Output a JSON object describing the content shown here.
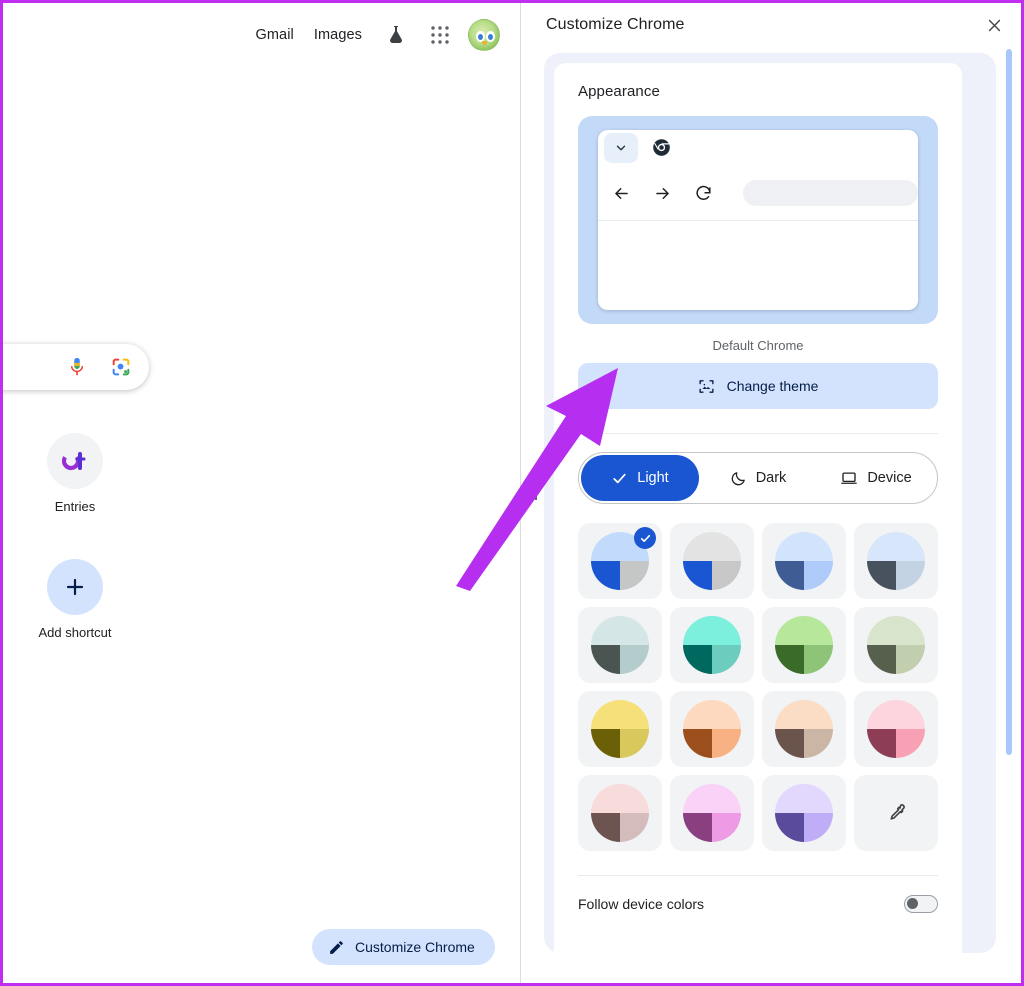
{
  "ntp": {
    "header": {
      "links": [
        {
          "label": "Gmail",
          "name": "gmail-link"
        },
        {
          "label": "Images",
          "name": "images-link"
        }
      ],
      "labs_icon": "flask-icon",
      "apps_icon": "apps-grid-icon",
      "avatar": "account-avatar"
    },
    "search": {
      "voice_icon": "microphone-icon",
      "lens_icon": "google-lens-icon"
    },
    "shortcuts": [
      {
        "label": "Entries",
        "tile": "ot-favicon",
        "style": "grey"
      },
      {
        "label": "Add shortcut",
        "tile": "plus-icon",
        "style": "blue"
      }
    ],
    "customize_button": {
      "label": "Customize Chrome",
      "icon": "pencil-icon"
    }
  },
  "panel": {
    "title": "Customize Chrome",
    "close_icon": "close-icon",
    "section_title": "Appearance",
    "preview": {
      "caption": "Default Chrome",
      "chevron_icon": "chevron-down-icon",
      "brand_icon": "chrome-logo-icon",
      "back_icon": "arrow-back-icon",
      "forward_icon": "arrow-forward-icon",
      "reload_icon": "reload-icon"
    },
    "change_theme": {
      "label": "Change theme",
      "icon": "image-frame-icon"
    },
    "modes": [
      {
        "label": "Light",
        "icon": "check-icon",
        "selected": true
      },
      {
        "label": "Dark",
        "icon": "moon-icon",
        "selected": false
      },
      {
        "label": "Device",
        "icon": "laptop-icon",
        "selected": false
      }
    ],
    "selected_mode": "Light",
    "colors_selected_index": 0,
    "color_swatches": [
      {
        "name": "default-blue",
        "top": "#c2dbfc",
        "bl": "#1a56d2",
        "br": "#c4c7c5",
        "selected": true
      },
      {
        "name": "grey-blue",
        "top": "#e3e3e3",
        "bl": "#1a56d2",
        "br": "#c8c8c8",
        "selected": false
      },
      {
        "name": "slate-blue",
        "top": "#d2e3fd",
        "bl": "#3f5d94",
        "br": "#aecbfa",
        "selected": false
      },
      {
        "name": "steel-blue",
        "top": "#d8e6fb",
        "bl": "#48525f",
        "br": "#c3d3e3",
        "selected": false
      },
      {
        "name": "pale-cyan",
        "top": "#d5e6e6",
        "bl": "#4a5552",
        "br": "#b4cccb",
        "selected": false
      },
      {
        "name": "aqua",
        "top": "#7cf0dd",
        "bl": "#00695f",
        "br": "#6cccbe",
        "selected": false
      },
      {
        "name": "light-green",
        "top": "#b7e79a",
        "bl": "#3a6b29",
        "br": "#8dc478",
        "selected": false
      },
      {
        "name": "sage",
        "top": "#d9e4cd",
        "bl": "#57604d",
        "br": "#c2cfae",
        "selected": false
      },
      {
        "name": "yellow",
        "top": "#f5e07a",
        "bl": "#6b6007",
        "br": "#d9c85c",
        "selected": false
      },
      {
        "name": "peach",
        "top": "#fcd9bf",
        "bl": "#9c4f1d",
        "br": "#f8b183",
        "selected": false
      },
      {
        "name": "tan",
        "top": "#fbddc6",
        "bl": "#6a544c",
        "br": "#cbb6a6",
        "selected": false
      },
      {
        "name": "rose",
        "top": "#fcd5de",
        "bl": "#8e3d56",
        "br": "#f9a1b4",
        "selected": false
      },
      {
        "name": "dusty-pink",
        "top": "#f8dbdb",
        "bl": "#6e5450",
        "br": "#d4bcbd",
        "selected": false
      },
      {
        "name": "magenta",
        "top": "#fbd2f7",
        "bl": "#8a4080",
        "br": "#ef9ae4",
        "selected": false
      },
      {
        "name": "lavender",
        "top": "#e2d7fd",
        "bl": "#5b4b9c",
        "br": "#bfaef7",
        "selected": false
      },
      {
        "name": "custom-color",
        "custom": true,
        "icon": "eyedropper-icon",
        "selected": false
      }
    ],
    "follow_device": {
      "label": "Follow device colors",
      "enabled": false
    },
    "scrollbar_color": "#a8c7fa"
  },
  "annotation": {
    "arrow_color": "#b62ef0",
    "points_to": "change-theme-button"
  }
}
